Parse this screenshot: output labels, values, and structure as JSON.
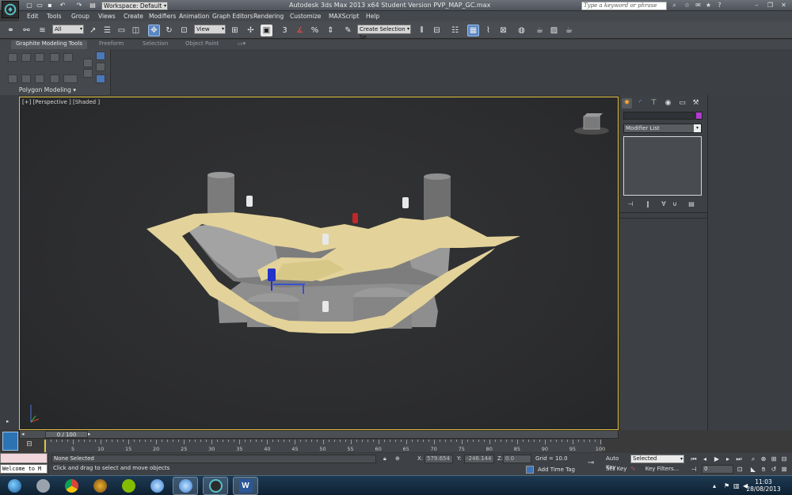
{
  "title_bar": {
    "workspace": "Workspace: Default",
    "window_title": "Autodesk 3ds Max  2013 x64    Student Version    PVP_MAP_GC.max",
    "search_placeholder": "Type a keyword or phrase"
  },
  "menu": [
    "Edit",
    "Tools",
    "Group",
    "Views",
    "Create",
    "Modifiers",
    "Animation",
    "Graph Editors",
    "Rendering",
    "Customize",
    "MAXScript",
    "Help"
  ],
  "toolbar": {
    "filter_select": "All",
    "reference_coord": "View",
    "named_selection": "Create Selection Se",
    "angle_snap_label": "3",
    "percent_snap_label": "%"
  },
  "ribbon": {
    "tabs": [
      "Graphite Modeling Tools",
      "Freeform",
      "Selection",
      "Object Paint"
    ],
    "panel_label": "Polygon Modeling"
  },
  "viewport": {
    "label": "[+] [Perspective ] [Shaded ]"
  },
  "command_panel": {
    "modifier_list": "Modifier List"
  },
  "timeline": {
    "frame_counter": "0 / 100",
    "ticks": [
      5,
      10,
      15,
      20,
      25,
      30,
      35,
      40,
      45,
      50,
      55,
      60,
      65,
      70,
      75,
      80,
      85,
      90,
      95,
      100
    ]
  },
  "status": {
    "line1": "None Selected",
    "line2": "Click and drag to select and move objects",
    "maxscript": "Welcome to M",
    "x_label": "X:",
    "x_value": "579.654",
    "y_label": "Y:",
    "y_value": "-246.144",
    "z_label": "Z:",
    "z_value": "0.0",
    "grid": "Grid = 10.0",
    "add_time_tag": "Add Time Tag"
  },
  "animation": {
    "auto_key": "Auto Key",
    "set_key": "Set Key",
    "selected_dropdown": "Selected",
    "key_filters": "Key Filters...",
    "frame_value": "0"
  },
  "taskbar": {
    "time": "11:03",
    "date": "28/08/2013"
  }
}
